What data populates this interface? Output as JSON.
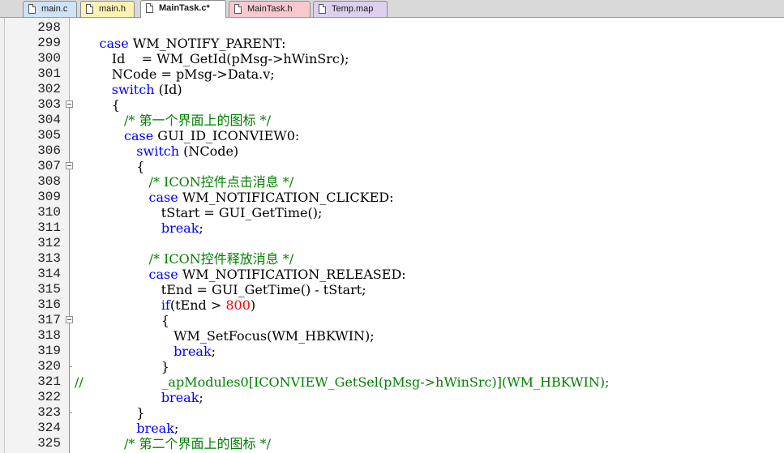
{
  "tabs": [
    {
      "label": "main.c",
      "color": "#cfe3f7",
      "active": false
    },
    {
      "label": "main.h",
      "color": "#fff2b3",
      "active": false
    },
    {
      "label": "MainTask.c*",
      "color": "#ffffff",
      "active": true
    },
    {
      "label": "MainTask.h",
      "color": "#f7c9cf",
      "active": false
    },
    {
      "label": "Temp.map",
      "color": "#ddd0ee",
      "active": false
    }
  ],
  "colors": {
    "keyword": "#0000ff",
    "comment": "#008000",
    "number": "#ff0000",
    "text": "#000000"
  },
  "lines": [
    {
      "n": "298",
      "segs": []
    },
    {
      "n": "299",
      "segs": [
        [
          "t",
          "      "
        ],
        [
          "k",
          "case"
        ],
        [
          "t",
          " WM_NOTIFY_PARENT:"
        ]
      ]
    },
    {
      "n": "300",
      "segs": [
        [
          "t",
          "         Id    = WM_GetId(pMsg->hWinSrc);"
        ]
      ]
    },
    {
      "n": "301",
      "segs": [
        [
          "t",
          "         NCode = pMsg->Data.v;"
        ]
      ]
    },
    {
      "n": "302",
      "segs": [
        [
          "t",
          "         "
        ],
        [
          "k",
          "switch"
        ],
        [
          "t",
          " (Id)"
        ]
      ]
    },
    {
      "n": "303",
      "fold": true,
      "segs": [
        [
          "t",
          "         {"
        ]
      ]
    },
    {
      "n": "304",
      "segs": [
        [
          "t",
          "            "
        ],
        [
          "c",
          "/* 第一个界面上的图标 */"
        ]
      ]
    },
    {
      "n": "305",
      "segs": [
        [
          "t",
          "            "
        ],
        [
          "k",
          "case"
        ],
        [
          "t",
          " GUI_ID_ICONVIEW0:"
        ]
      ]
    },
    {
      "n": "306",
      "segs": [
        [
          "t",
          "               "
        ],
        [
          "k",
          "switch"
        ],
        [
          "t",
          " (NCode)"
        ]
      ]
    },
    {
      "n": "307",
      "fold": true,
      "segs": [
        [
          "t",
          "               {"
        ]
      ]
    },
    {
      "n": "308",
      "segs": [
        [
          "t",
          "                  "
        ],
        [
          "c",
          "/* ICON控件点击消息 */"
        ]
      ]
    },
    {
      "n": "309",
      "segs": [
        [
          "t",
          "                  "
        ],
        [
          "k",
          "case"
        ],
        [
          "t",
          " WM_NOTIFICATION_CLICKED:"
        ]
      ]
    },
    {
      "n": "310",
      "segs": [
        [
          "t",
          "                     tStart = GUI_GetTime();"
        ]
      ]
    },
    {
      "n": "311",
      "segs": [
        [
          "t",
          "                     "
        ],
        [
          "k",
          "break"
        ],
        [
          "t",
          ";"
        ]
      ]
    },
    {
      "n": "312",
      "segs": []
    },
    {
      "n": "313",
      "segs": [
        [
          "t",
          "                  "
        ],
        [
          "c",
          "/* ICON控件释放消息 */"
        ]
      ]
    },
    {
      "n": "314",
      "segs": [
        [
          "t",
          "                  "
        ],
        [
          "k",
          "case"
        ],
        [
          "t",
          " WM_NOTIFICATION_RELEASED:"
        ]
      ]
    },
    {
      "n": "315",
      "segs": [
        [
          "t",
          "                     tEnd = GUI_GetTime() - tStart;"
        ]
      ]
    },
    {
      "n": "316",
      "segs": [
        [
          "t",
          "                     "
        ],
        [
          "k",
          "if"
        ],
        [
          "t",
          "(tEnd > "
        ],
        [
          "n",
          "800"
        ],
        [
          "t",
          ")"
        ]
      ]
    },
    {
      "n": "317",
      "fold": true,
      "segs": [
        [
          "t",
          "                     {"
        ]
      ]
    },
    {
      "n": "318",
      "segs": [
        [
          "t",
          "                        WM_SetFocus(WM_HBKWIN);"
        ]
      ]
    },
    {
      "n": "319",
      "segs": [
        [
          "t",
          "                        "
        ],
        [
          "k",
          "break"
        ],
        [
          "t",
          ";"
        ]
      ]
    },
    {
      "n": "320",
      "segs": [
        [
          "t",
          "                     }"
        ]
      ]
    },
    {
      "n": "321",
      "segs": [
        [
          "c",
          "//                   _apModules0[ICONVIEW_GetSel(pMsg->hWinSrc)](WM_HBKWIN);"
        ]
      ]
    },
    {
      "n": "322",
      "segs": [
        [
          "t",
          "                     "
        ],
        [
          "k",
          "break"
        ],
        [
          "t",
          ";"
        ]
      ]
    },
    {
      "n": "323",
      "segs": [
        [
          "t",
          "               }"
        ]
      ]
    },
    {
      "n": "324",
      "segs": [
        [
          "t",
          "               "
        ],
        [
          "k",
          "break"
        ],
        [
          "t",
          ";"
        ]
      ]
    },
    {
      "n": "325",
      "segs": [
        [
          "t",
          "            "
        ],
        [
          "c",
          "/* 第二个界面上的图标 */"
        ]
      ]
    }
  ]
}
